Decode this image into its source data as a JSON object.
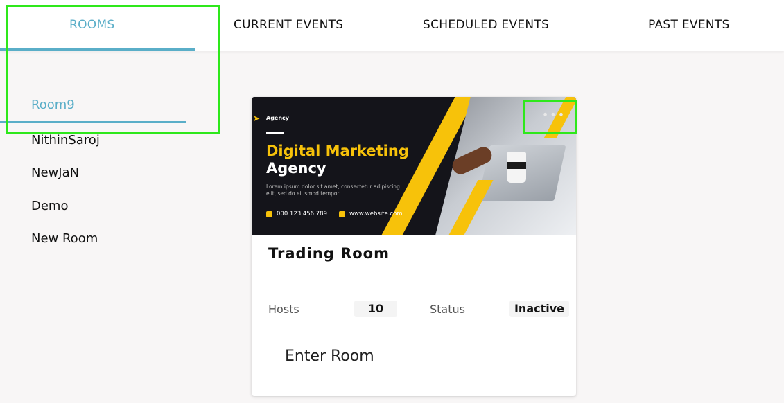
{
  "tabs": [
    {
      "label": "ROOMS",
      "active": true
    },
    {
      "label": "CURRENT EVENTS",
      "active": false
    },
    {
      "label": "SCHEDULED EVENTS",
      "active": false
    },
    {
      "label": "PAST EVENTS",
      "active": false
    }
  ],
  "rooms": [
    {
      "label": "Room9",
      "active": true
    },
    {
      "label": "NithinSaroj",
      "active": false
    },
    {
      "label": "NewJaN",
      "active": false
    },
    {
      "label": "Demo",
      "active": false
    },
    {
      "label": "New Room",
      "active": false
    }
  ],
  "card": {
    "banner": {
      "agency": "Agency",
      "title_line1": "Digital Marketing",
      "title_line2": "Agency",
      "lorem": "Lorem ipsum dolor sit amet, consectetur adipiscing elit, sed do eiusmod tempor",
      "phone": "000 123 456 789",
      "website": "www.website.com"
    },
    "menu_icon": "more-dots-icon",
    "title": "Trading Room",
    "hosts_label": "Hosts",
    "hosts_value": "10",
    "status_label": "Status",
    "status_value": "Inactive",
    "enter_label": "Enter Room"
  },
  "colors": {
    "accent": "#5aaec8",
    "banner_yellow": "#f7c20a",
    "highlight": "#2ee81b"
  }
}
